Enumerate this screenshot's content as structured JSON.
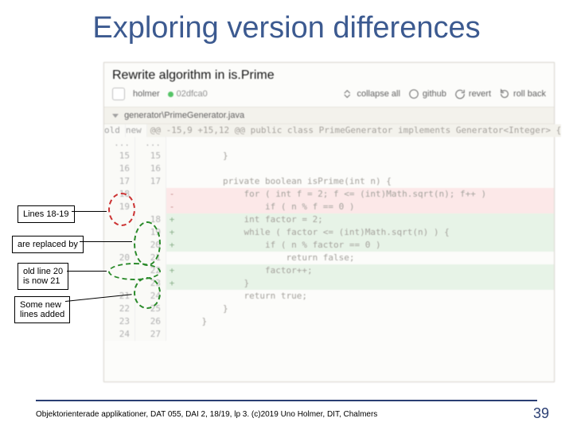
{
  "title": "Exploring version differences",
  "commit_message": "Rewrite algorithm in is.Prime",
  "author": "holmer",
  "hash": "02dfca0",
  "toolbar": {
    "collapse": "collapse all",
    "github": "github",
    "revert": "revert",
    "rollback": "roll back"
  },
  "file_path": "generator\\PrimeGenerator.java",
  "col_headers": {
    "old": "old",
    "new": "new"
  },
  "hunk": "@@ -15,9 +15,12 @@ public class PrimeGenerator implements Generator<Integer> {",
  "lines": [
    {
      "old": "...",
      "new": "...",
      "type": "ctx",
      "code": ""
    },
    {
      "old": "15",
      "new": "15",
      "type": "ctx",
      "code": "        }"
    },
    {
      "old": "16",
      "new": "16",
      "type": "ctx",
      "code": ""
    },
    {
      "old": "17",
      "new": "17",
      "type": "ctx",
      "code": "        private boolean isPrime(int n) {"
    },
    {
      "old": "18",
      "new": "",
      "type": "del",
      "code": "            for ( int f = 2; f <= (int)Math.sqrt(n); f++ )"
    },
    {
      "old": "19",
      "new": "",
      "type": "del",
      "code": "                if ( n % f == 0 )"
    },
    {
      "old": "",
      "new": "18",
      "type": "add",
      "code": "            int factor = 2;"
    },
    {
      "old": "",
      "new": "19",
      "type": "add",
      "code": "            while ( factor <= (int)Math.sqrt(n) ) {"
    },
    {
      "old": "",
      "new": "20",
      "type": "add",
      "code": "                if ( n % factor == 0 )"
    },
    {
      "old": "20",
      "new": "21",
      "type": "ctx",
      "code": "                    return false;"
    },
    {
      "old": "",
      "new": "22",
      "type": "add",
      "code": "                factor++;"
    },
    {
      "old": "",
      "new": "23",
      "type": "add",
      "code": "            }"
    },
    {
      "old": "21",
      "new": "24",
      "type": "ctx",
      "code": "            return true;"
    },
    {
      "old": "22",
      "new": "25",
      "type": "ctx",
      "code": "        }"
    },
    {
      "old": "23",
      "new": "26",
      "type": "ctx",
      "code": "    }"
    },
    {
      "old": "24",
      "new": "27",
      "type": "ctx",
      "code": ""
    }
  ],
  "callouts": {
    "c1": "Lines 18-19",
    "c2": "are replaced by",
    "c3_l1": "old line 20",
    "c3_l2": "is now 21",
    "c4_l1": "Some new",
    "c4_l2": "lines added"
  },
  "footer": "Objektorienterade applikationer, DAT 055, DAI 2, 18/19, lp 3. (c)2019 Uno Holmer, DIT, Chalmers",
  "page": "39"
}
